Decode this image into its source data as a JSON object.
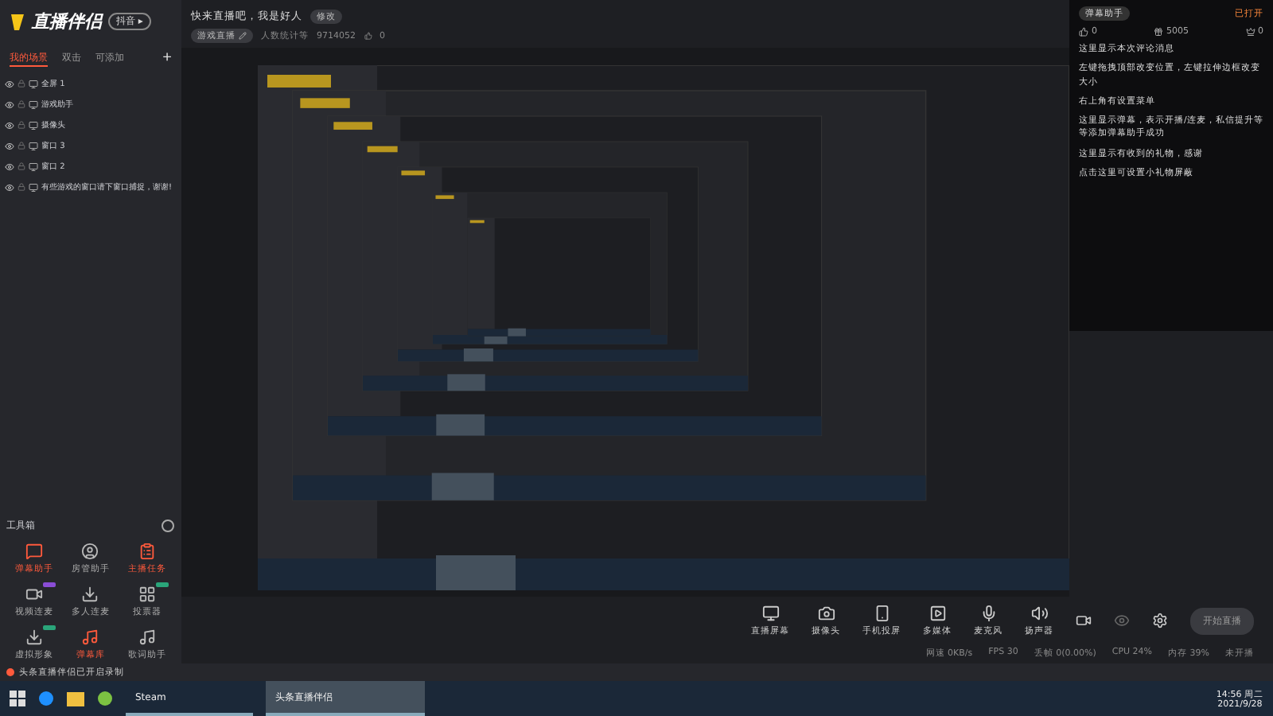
{
  "app": {
    "logo": "直播伴侣",
    "badge": "抖音 ▸"
  },
  "scene_tabs": [
    {
      "label": "我的场景",
      "selected": true
    },
    {
      "label": "双击",
      "selected": false
    },
    {
      "label": "可添加",
      "selected": false
    }
  ],
  "add_scene": "+",
  "sources": [
    {
      "name": "全屏 1",
      "visible": true
    },
    {
      "name": "游戏助手",
      "visible": true
    },
    {
      "name": "摄像头",
      "visible": true
    },
    {
      "name": "窗口 3",
      "visible": true
    },
    {
      "name": "窗口 2",
      "visible": true
    },
    {
      "name": "有些游戏的窗口请下窗口捕捉，谢谢!",
      "visible": true
    }
  ],
  "toolbox": {
    "title": "工具箱",
    "items": [
      {
        "label": "弹幕助手",
        "highlighted": true
      },
      {
        "label": "房管助手",
        "highlighted": false
      },
      {
        "label": "主播任务",
        "highlighted": true
      },
      {
        "label": "视频连麦",
        "highlighted": false,
        "color": "#8a4dd6"
      },
      {
        "label": "多人连麦",
        "highlighted": false
      },
      {
        "label": "投票器",
        "highlighted": false,
        "color": "#2aa57a"
      },
      {
        "label": "虚拟形象",
        "highlighted": false,
        "color": "#2aa57a"
      },
      {
        "label": "弹幕库",
        "highlighted": true
      },
      {
        "label": "歌词助手",
        "highlighted": false
      }
    ]
  },
  "stream_info": {
    "title": "快来直播吧，我是好人",
    "edit": "修改",
    "category": "游戏直播",
    "stats": [
      "人数统计等",
      "9714052"
    ],
    "likes": "0"
  },
  "chat_panel": {
    "title": "弹幕助手",
    "status": "已打开",
    "counts": [
      "0",
      "5005",
      "0"
    ],
    "messages": [
      "这里显示本次评论消息",
      "左键拖拽顶部改变位置，左键拉伸边框改变大小",
      "右上角有设置菜单",
      "这里显示弹幕，表示开播/连麦，私信提升等等添加弹幕助手成功",
      "这里显示有收到的礼物，感谢",
      "点击这里可设置小礼物屏蔽"
    ]
  },
  "controls": [
    "直播屏幕",
    "摄像头",
    "手机投屏",
    "多媒体",
    "麦克风",
    "扬声器"
  ],
  "start_button": "开始直播",
  "status_items": [
    "网速 0KB/s",
    "FPS 30",
    "丢帧 0(0.00%)",
    "CPU 24%",
    "内存 39%",
    "未开播"
  ],
  "notification": "头条直播伴侣已开启录制",
  "taskbar": {
    "apps": [
      {
        "label": "Steam",
        "selected": false
      },
      {
        "label": "头条直播伴侣",
        "selected": true
      }
    ],
    "time": "14:56 周二",
    "date": "2021/9/28"
  }
}
